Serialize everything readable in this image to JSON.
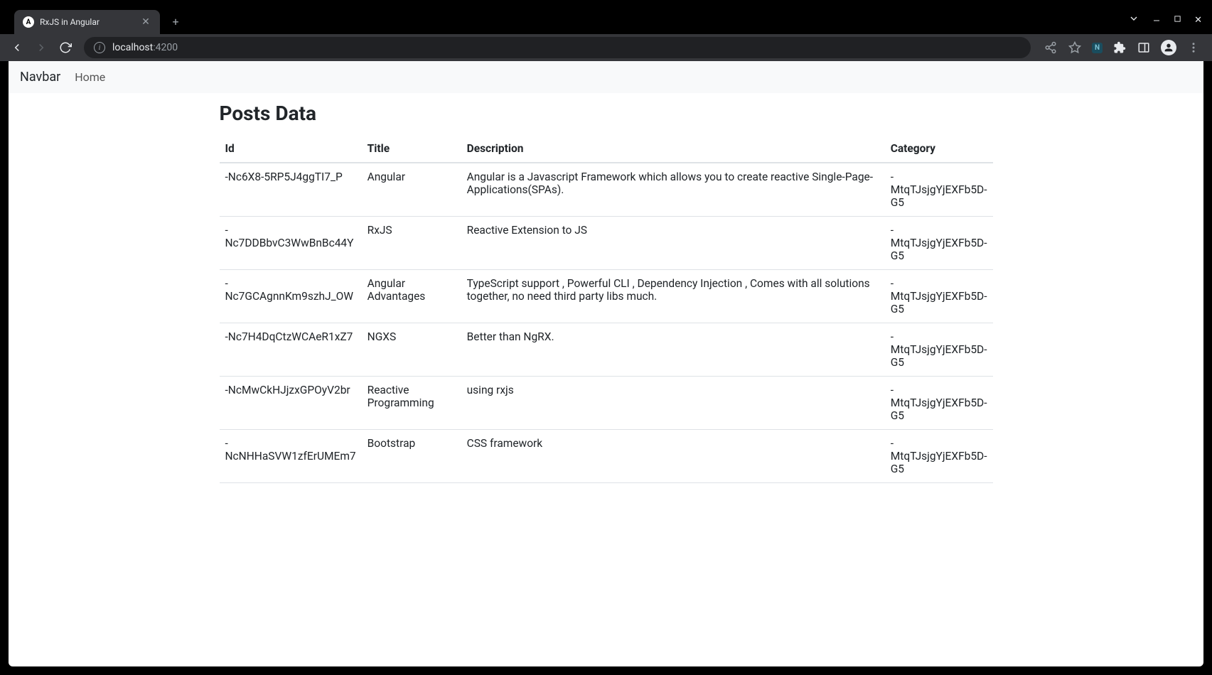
{
  "browser": {
    "tab_title": "RxJS in Angular",
    "url_host": "localhost",
    "url_port": ":4200"
  },
  "navbar": {
    "brand": "Navbar",
    "home": "Home"
  },
  "page": {
    "heading": "Posts Data"
  },
  "table": {
    "headers": {
      "id": "Id",
      "title": "Title",
      "description": "Description",
      "category": "Category"
    },
    "rows": [
      {
        "id": "-Nc6X8-5RP5J4ggTI7_P",
        "title": "Angular",
        "description": "Angular is a Javascript Framework which allows you to create reactive Single-Page-Applications(SPAs).",
        "category": "-MtqTJsjgYjEXFb5D-G5"
      },
      {
        "id": "-Nc7DDBbvC3WwBnBc44Y",
        "title": "RxJS",
        "description": "Reactive Extension to JS",
        "category": "-MtqTJsjgYjEXFb5D-G5"
      },
      {
        "id": "-Nc7GCAgnnKm9szhJ_OW",
        "title": "Angular Advantages",
        "description": "TypeScript support , Powerful CLI , Dependency Injection , Comes with all solutions together, no need third party libs much.",
        "category": "-MtqTJsjgYjEXFb5D-G5"
      },
      {
        "id": "-Nc7H4DqCtzWCAeR1xZ7",
        "title": "NGXS",
        "description": "Better than NgRX.",
        "category": "-MtqTJsjgYjEXFb5D-G5"
      },
      {
        "id": "-NcMwCkHJjzxGPOyV2br",
        "title": "Reactive Programming",
        "description": "using rxjs",
        "category": "-MtqTJsjgYjEXFb5D-G5"
      },
      {
        "id": "-NcNHHaSVW1zfErUMEm7",
        "title": "Bootstrap",
        "description": "CSS framework",
        "category": "-MtqTJsjgYjEXFb5D-G5"
      }
    ]
  }
}
